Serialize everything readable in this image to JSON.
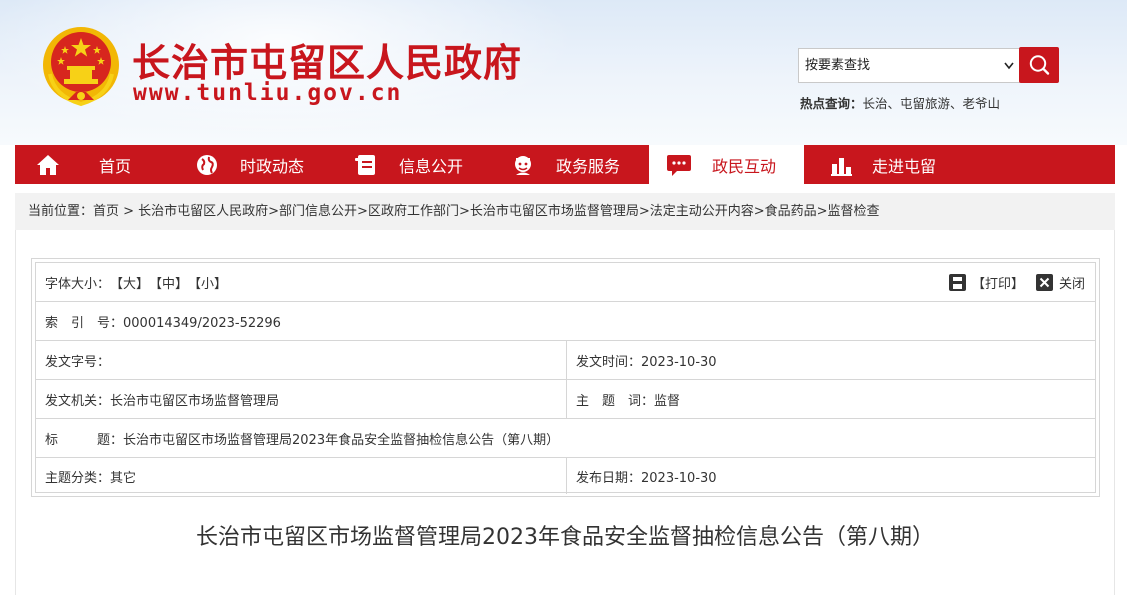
{
  "header": {
    "site_name": "长治市屯留区人民政府",
    "site_url": "www.tunliu.gov.cn",
    "search": {
      "selected": "按要素查找"
    },
    "hot": {
      "label": "热点查询：",
      "items": "长治、屯留旅游、老爷山"
    }
  },
  "nav": {
    "items": [
      {
        "label": "首页",
        "icon": "home-icon"
      },
      {
        "label": "时政动态",
        "icon": "globe-icon"
      },
      {
        "label": "信息公开",
        "icon": "document-icon"
      },
      {
        "label": "政务服务",
        "icon": "person-icon"
      },
      {
        "label": "政民互动",
        "icon": "chat-icon",
        "active": true
      },
      {
        "label": "走进屯留",
        "icon": "chart-icon"
      }
    ]
  },
  "breadcrumb": "当前位置：首页 > 长治市屯留区人民政府>部门信息公开>区政府工作部门>长治市屯留区市场监督管理局>法定主动公开内容>食品药品>监督检查",
  "info": {
    "font_size": {
      "label": "字体大小：",
      "large": "【大】",
      "medium": "【中】",
      "small": "【小】"
    },
    "print": "【打印】",
    "close": "关闭",
    "index_no": "索　引　号：000014349/2023-52296",
    "doc_no": "发文字号：",
    "issue_time": "发文时间：2023-10-30",
    "issuer": "发文机关：长治市屯留区市场监督管理局",
    "subject_words": "主　题　词：监督",
    "title": "标　　　题：长治市屯留区市场监督管理局2023年食品安全监督抽检信息公告（第八期）",
    "category": "主题分类：其它",
    "publish_date": "发布日期：2023-10-30"
  },
  "doc_title": "长治市屯留区市场监督管理局2023年食品安全监督抽检信息公告（第八期）",
  "colors": {
    "brand_red": "#c8161d",
    "gold": "#f2b705"
  }
}
